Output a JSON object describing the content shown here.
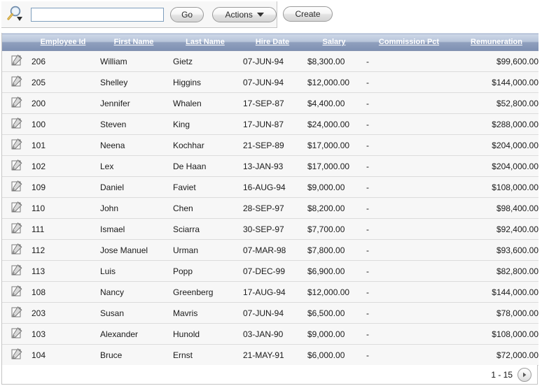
{
  "toolbar": {
    "search_icon": "magnifier-dropdown-icon",
    "search_value": "",
    "search_placeholder": "",
    "go_label": "Go",
    "actions_label": "Actions",
    "create_label": "Create"
  },
  "report": {
    "columns": [
      {
        "key": "edit",
        "label": "",
        "align": "center"
      },
      {
        "key": "employee_id",
        "label": "Employee Id",
        "align": "left"
      },
      {
        "key": "first_name",
        "label": "First Name",
        "align": "left"
      },
      {
        "key": "last_name",
        "label": "Last Name",
        "align": "left"
      },
      {
        "key": "hire_date",
        "label": "Hire Date",
        "align": "left"
      },
      {
        "key": "salary",
        "label": "Salary",
        "align": "left"
      },
      {
        "key": "commission",
        "label": "Commission Pct",
        "align": "left"
      },
      {
        "key": "remuneration",
        "label": "Remuneration",
        "align": "right"
      }
    ],
    "rows": [
      {
        "employee_id": "206",
        "first_name": "William",
        "last_name": "Gietz",
        "hire_date": "07-JUN-94",
        "salary": "$8,300.00",
        "commission": "-",
        "remuneration": "$99,600.00"
      },
      {
        "employee_id": "205",
        "first_name": "Shelley",
        "last_name": "Higgins",
        "hire_date": "07-JUN-94",
        "salary": "$12,000.00",
        "commission": "-",
        "remuneration": "$144,000.00"
      },
      {
        "employee_id": "200",
        "first_name": "Jennifer",
        "last_name": "Whalen",
        "hire_date": "17-SEP-87",
        "salary": "$4,400.00",
        "commission": "-",
        "remuneration": "$52,800.00"
      },
      {
        "employee_id": "100",
        "first_name": "Steven",
        "last_name": "King",
        "hire_date": "17-JUN-87",
        "salary": "$24,000.00",
        "commission": "-",
        "remuneration": "$288,000.00"
      },
      {
        "employee_id": "101",
        "first_name": "Neena",
        "last_name": "Kochhar",
        "hire_date": "21-SEP-89",
        "salary": "$17,000.00",
        "commission": "-",
        "remuneration": "$204,000.00"
      },
      {
        "employee_id": "102",
        "first_name": "Lex",
        "last_name": "De Haan",
        "hire_date": "13-JAN-93",
        "salary": "$17,000.00",
        "commission": "-",
        "remuneration": "$204,000.00"
      },
      {
        "employee_id": "109",
        "first_name": "Daniel",
        "last_name": "Faviet",
        "hire_date": "16-AUG-94",
        "salary": "$9,000.00",
        "commission": "-",
        "remuneration": "$108,000.00"
      },
      {
        "employee_id": "110",
        "first_name": "John",
        "last_name": "Chen",
        "hire_date": "28-SEP-97",
        "salary": "$8,200.00",
        "commission": "-",
        "remuneration": "$98,400.00"
      },
      {
        "employee_id": "111",
        "first_name": "Ismael",
        "last_name": "Sciarra",
        "hire_date": "30-SEP-97",
        "salary": "$7,700.00",
        "commission": "-",
        "remuneration": "$92,400.00"
      },
      {
        "employee_id": "112",
        "first_name": "Jose Manuel",
        "last_name": "Urman",
        "hire_date": "07-MAR-98",
        "salary": "$7,800.00",
        "commission": "-",
        "remuneration": "$93,600.00"
      },
      {
        "employee_id": "113",
        "first_name": "Luis",
        "last_name": "Popp",
        "hire_date": "07-DEC-99",
        "salary": "$6,900.00",
        "commission": "-",
        "remuneration": "$82,800.00"
      },
      {
        "employee_id": "108",
        "first_name": "Nancy",
        "last_name": "Greenberg",
        "hire_date": "17-AUG-94",
        "salary": "$12,000.00",
        "commission": "-",
        "remuneration": "$144,000.00"
      },
      {
        "employee_id": "203",
        "first_name": "Susan",
        "last_name": "Mavris",
        "hire_date": "07-JUN-94",
        "salary": "$6,500.00",
        "commission": "-",
        "remuneration": "$78,000.00"
      },
      {
        "employee_id": "103",
        "first_name": "Alexander",
        "last_name": "Hunold",
        "hire_date": "03-JAN-90",
        "salary": "$9,000.00",
        "commission": "-",
        "remuneration": "$108,000.00"
      },
      {
        "employee_id": "104",
        "first_name": "Bruce",
        "last_name": "Ernst",
        "hire_date": "21-MAY-91",
        "salary": "$6,000.00",
        "commission": "-",
        "remuneration": "$72,000.00"
      }
    ],
    "row_edit_icon": "edit-pencil-icon"
  },
  "footer": {
    "range_label": "1 - 15",
    "next_icon": "chevron-right-icon"
  },
  "colors": {
    "header_gradient_top": "#cfd9e8",
    "header_gradient_bottom": "#7e90b2",
    "row_bg": "#f7f7f7",
    "row_border": "#dcdcdc",
    "input_border": "#7e9ebd"
  }
}
